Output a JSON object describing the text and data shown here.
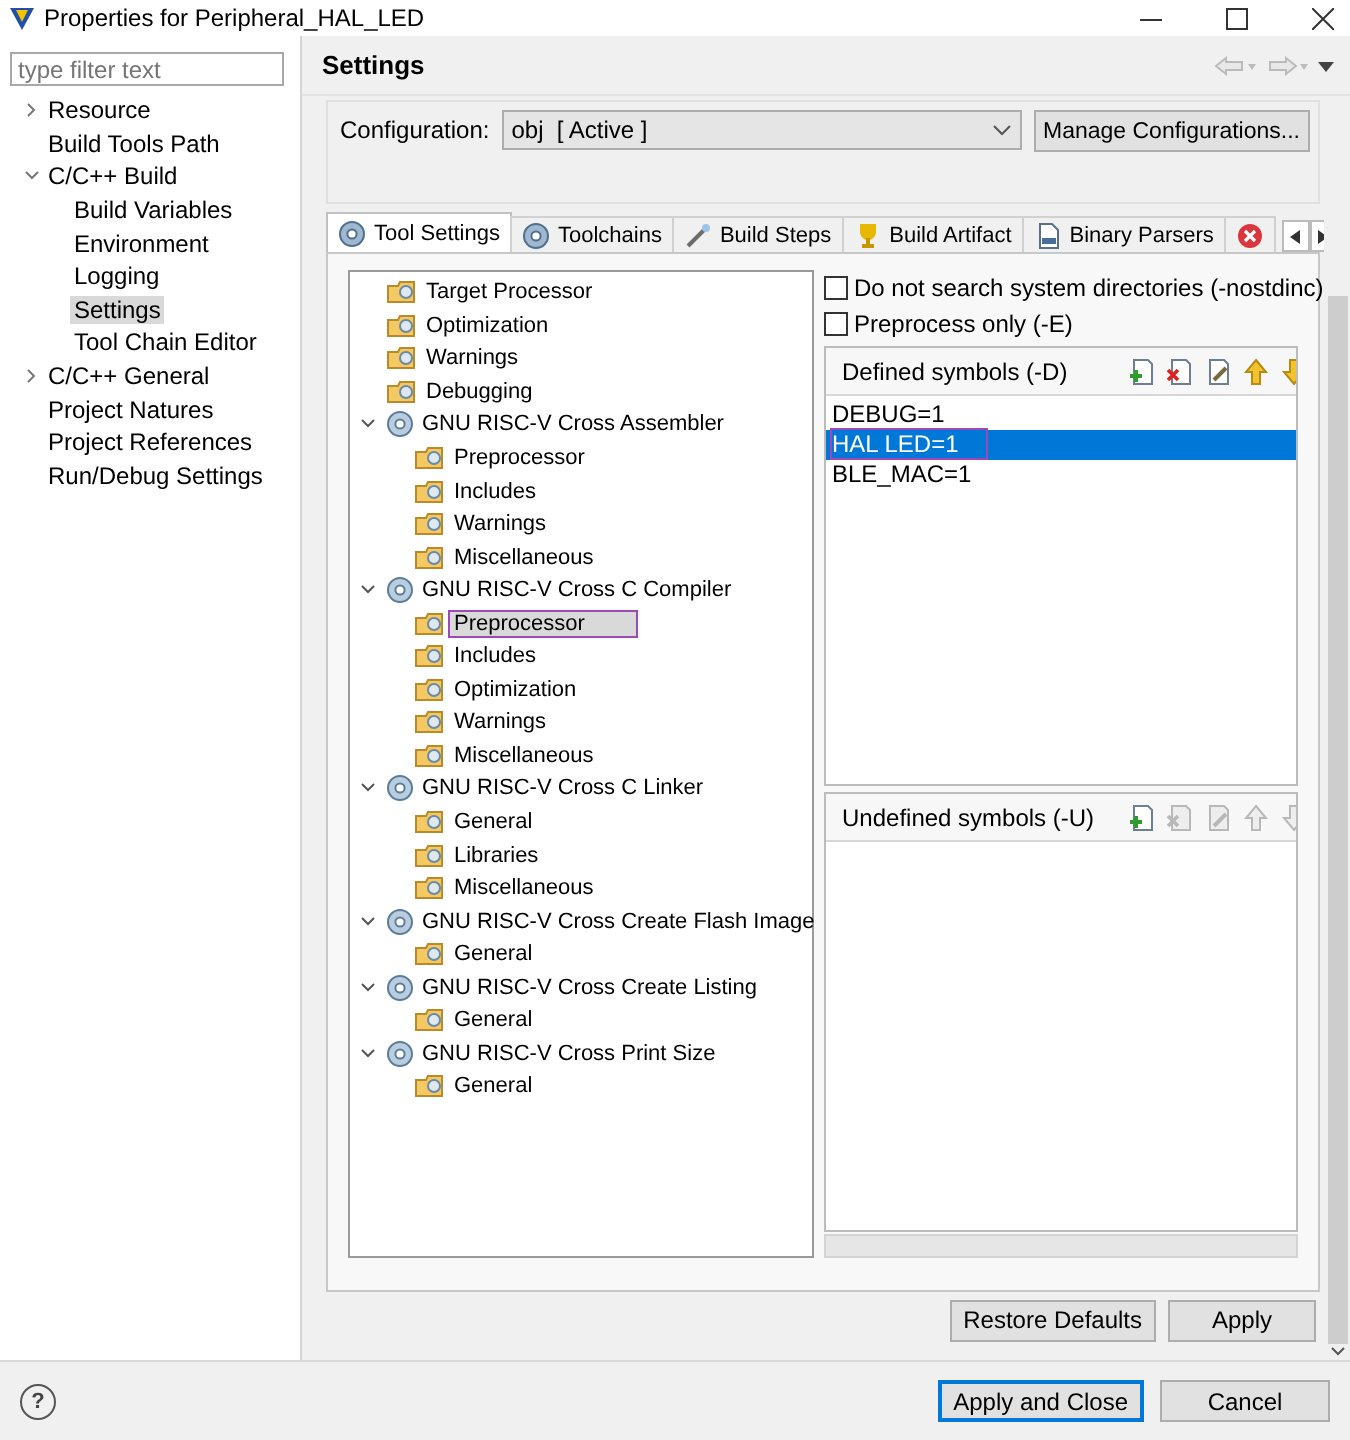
{
  "window": {
    "title": "Properties for Peripheral_HAL_LED"
  },
  "sidebar": {
    "filter": {
      "placeholder": "type filter text"
    },
    "items": [
      {
        "label": "Resource",
        "expanded": false,
        "selected": false
      },
      {
        "label": "Build Tools Path",
        "selected": false
      },
      {
        "label": "C/C++ Build",
        "expanded": true,
        "selected": false,
        "children": [
          {
            "label": "Build Variables",
            "selected": false
          },
          {
            "label": "Environment",
            "selected": false
          },
          {
            "label": "Logging",
            "selected": false
          },
          {
            "label": "Settings",
            "selected": true
          },
          {
            "label": "Tool Chain Editor",
            "selected": false
          }
        ]
      },
      {
        "label": "C/C++ General",
        "expanded": false,
        "selected": false
      },
      {
        "label": "Project Natures",
        "selected": false
      },
      {
        "label": "Project References",
        "selected": false
      },
      {
        "label": "Run/Debug Settings",
        "selected": false
      }
    ]
  },
  "page": {
    "title": "Settings"
  },
  "configuration": {
    "label": "Configuration:",
    "value": "obj  [ Active ]",
    "manage_button": "Manage Configurations..."
  },
  "tabs": [
    {
      "label": "Tool Settings",
      "kind": "gear",
      "selected": true
    },
    {
      "label": "Toolchains",
      "kind": "gear",
      "selected": false
    },
    {
      "label": "Build Steps",
      "kind": "wand",
      "selected": false
    },
    {
      "label": "Build Artifact",
      "kind": "trophy",
      "selected": false
    },
    {
      "label": "Binary Parsers",
      "kind": "binary",
      "selected": false
    },
    {
      "kind": "error",
      "selected": false
    }
  ],
  "tool_tree": [
    {
      "label": "Target Processor",
      "kind": "page",
      "selected": false
    },
    {
      "label": "Optimization",
      "kind": "page",
      "selected": false
    },
    {
      "label": "Warnings",
      "kind": "page",
      "selected": false
    },
    {
      "label": "Debugging",
      "kind": "page",
      "selected": false
    },
    {
      "label": "GNU RISC-V Cross Assembler",
      "kind": "tool",
      "expanded": true,
      "selected": false,
      "children": [
        {
          "label": "Preprocessor",
          "kind": "page",
          "selected": false
        },
        {
          "label": "Includes",
          "kind": "page",
          "selected": false
        },
        {
          "label": "Warnings",
          "kind": "page",
          "selected": false
        },
        {
          "label": "Miscellaneous",
          "kind": "page",
          "selected": false
        }
      ]
    },
    {
      "label": "GNU RISC-V Cross C Compiler",
      "kind": "tool",
      "expanded": true,
      "selected": false,
      "children": [
        {
          "label": "Preprocessor",
          "kind": "page",
          "selected": true,
          "annotated": true
        },
        {
          "label": "Includes",
          "kind": "page",
          "selected": false
        },
        {
          "label": "Optimization",
          "kind": "page",
          "selected": false
        },
        {
          "label": "Warnings",
          "kind": "page",
          "selected": false
        },
        {
          "label": "Miscellaneous",
          "kind": "page",
          "selected": false
        }
      ]
    },
    {
      "label": "GNU RISC-V Cross C Linker",
      "kind": "tool",
      "expanded": true,
      "selected": false,
      "children": [
        {
          "label": "General",
          "kind": "page",
          "selected": false
        },
        {
          "label": "Libraries",
          "kind": "page",
          "selected": false
        },
        {
          "label": "Miscellaneous",
          "kind": "page",
          "selected": false
        }
      ]
    },
    {
      "label": "GNU RISC-V Cross Create Flash Image",
      "kind": "tool",
      "expanded": true,
      "selected": false,
      "children": [
        {
          "label": "General",
          "kind": "page",
          "selected": false
        }
      ]
    },
    {
      "label": "GNU RISC-V Cross Create Listing",
      "kind": "tool",
      "expanded": true,
      "selected": false,
      "children": [
        {
          "label": "General",
          "kind": "page",
          "selected": false
        }
      ]
    },
    {
      "label": "GNU RISC-V Cross Print Size",
      "kind": "tool",
      "expanded": true,
      "selected": false,
      "children": [
        {
          "label": "General",
          "kind": "page",
          "selected": false
        }
      ]
    }
  ],
  "options": [
    {
      "label": "Do not search system directories (-nostdinc)",
      "checked": false
    },
    {
      "label": "Preprocess only (-E)",
      "checked": false
    }
  ],
  "defined_symbols": {
    "label": "Defined symbols (-D)",
    "tools": [
      {
        "kind": "add",
        "disabled": false
      },
      {
        "kind": "delete",
        "disabled": false
      },
      {
        "kind": "edit",
        "disabled": false
      },
      {
        "kind": "up",
        "disabled": false
      },
      {
        "kind": "down",
        "disabled": false
      }
    ],
    "entries": [
      {
        "text": "DEBUG=1",
        "selected": false,
        "annotated": false
      },
      {
        "text": "HAL LED=1",
        "selected": true,
        "annotated": true
      },
      {
        "text": "BLE_MAC=1",
        "selected": false,
        "annotated": false
      }
    ]
  },
  "undefined_symbols": {
    "label": "Undefined symbols (-U)",
    "tools": [
      {
        "kind": "add",
        "disabled": false
      },
      {
        "kind": "delete",
        "disabled": true
      },
      {
        "kind": "edit",
        "disabled": true
      },
      {
        "kind": "up",
        "disabled": true
      },
      {
        "kind": "down",
        "disabled": true
      }
    ]
  },
  "panel_buttons": [
    "Restore Defaults",
    "Apply"
  ],
  "dialog_buttons": [
    {
      "label": "Apply and Close",
      "default": true
    },
    {
      "label": "Cancel",
      "default": false
    }
  ],
  "help_button": "?"
}
